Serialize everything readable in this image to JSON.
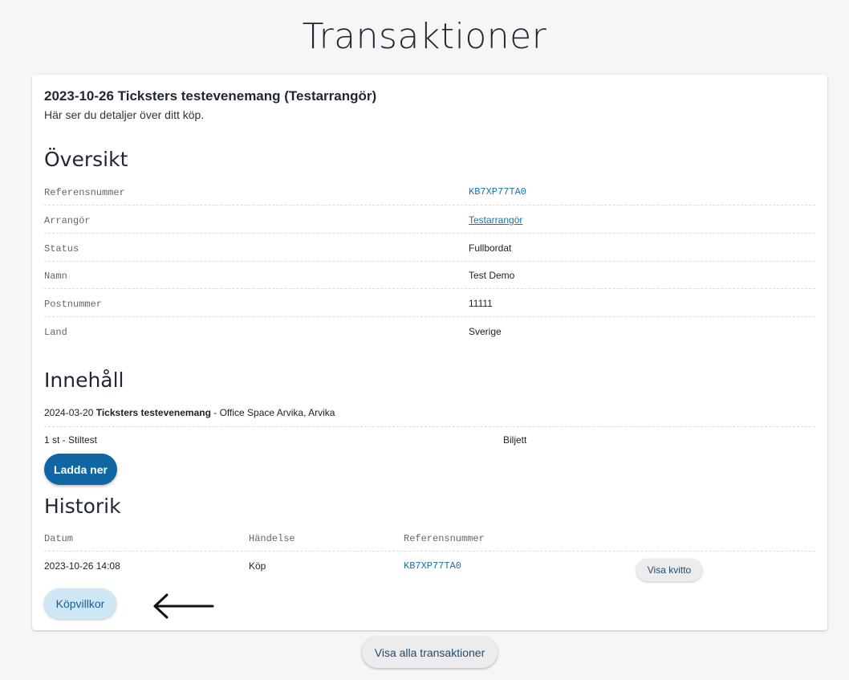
{
  "page": {
    "title": "Transaktioner"
  },
  "event": {
    "title": "2023-10-26 Ticksters testevenemang (Testarrangör)",
    "subtitle": "Här ser du detaljer över ditt köp."
  },
  "overview": {
    "heading": "Översikt",
    "rows": [
      {
        "key": "Referensnummer",
        "value": "KB7XP77TA0"
      },
      {
        "key": "Arrangör",
        "value": "Testarrangör"
      },
      {
        "key": "Status",
        "value": "Fullbordat"
      },
      {
        "key": "Namn",
        "value": "Test Demo"
      },
      {
        "key": "Postnummer",
        "value": "11111"
      },
      {
        "key": "Land",
        "value": "Sverige"
      }
    ]
  },
  "content": {
    "heading": "Innehåll",
    "event_date": "2024-03-20",
    "event_name": "Ticksters testevenemang",
    "event_location": " - Office Space Arvika, Arvika",
    "item": "1 st - Stiltest",
    "item_type": "Biljett",
    "download_label": "Ladda ner"
  },
  "history": {
    "heading": "Historik",
    "columns": [
      "Datum",
      "Händelse",
      "Referensnummer"
    ],
    "rows": [
      {
        "date": "2023-10-26 14:08",
        "event": "Köp",
        "ref": "KB7XP77TA0",
        "action": "Visa kvitto"
      }
    ]
  },
  "buttons": {
    "terms": "Köpvillkor",
    "all_transactions": "Visa alla transaktioner"
  },
  "colors": {
    "primary": "#0f66a3",
    "link": "#1a73a8",
    "terms_bg": "#cfe6f5"
  }
}
